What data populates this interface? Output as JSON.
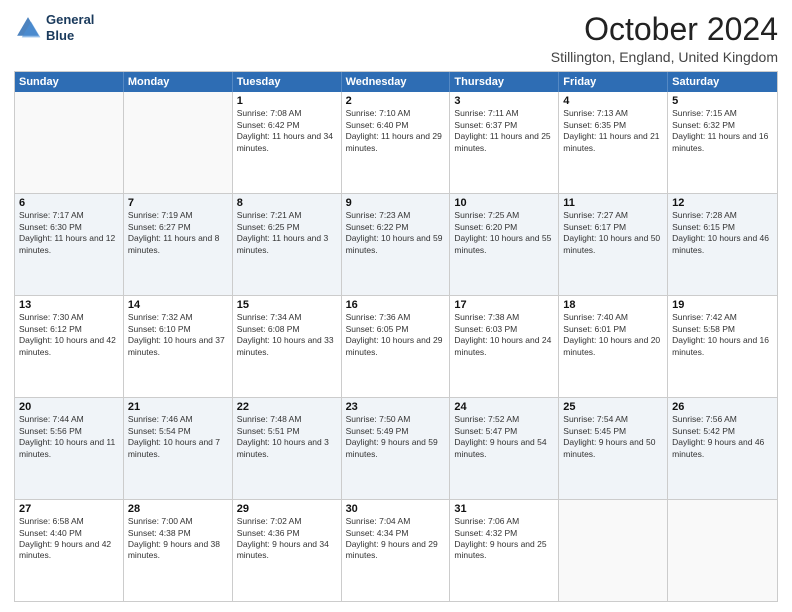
{
  "header": {
    "logo_line1": "General",
    "logo_line2": "Blue",
    "title": "October 2024",
    "subtitle": "Stillington, England, United Kingdom"
  },
  "days_of_week": [
    "Sunday",
    "Monday",
    "Tuesday",
    "Wednesday",
    "Thursday",
    "Friday",
    "Saturday"
  ],
  "weeks": [
    [
      {
        "day": "",
        "sunrise": "",
        "sunset": "",
        "daylight": "",
        "alt": false
      },
      {
        "day": "",
        "sunrise": "",
        "sunset": "",
        "daylight": "",
        "alt": false
      },
      {
        "day": "1",
        "sunrise": "Sunrise: 7:08 AM",
        "sunset": "Sunset: 6:42 PM",
        "daylight": "Daylight: 11 hours and 34 minutes.",
        "alt": false
      },
      {
        "day": "2",
        "sunrise": "Sunrise: 7:10 AM",
        "sunset": "Sunset: 6:40 PM",
        "daylight": "Daylight: 11 hours and 29 minutes.",
        "alt": false
      },
      {
        "day": "3",
        "sunrise": "Sunrise: 7:11 AM",
        "sunset": "Sunset: 6:37 PM",
        "daylight": "Daylight: 11 hours and 25 minutes.",
        "alt": false
      },
      {
        "day": "4",
        "sunrise": "Sunrise: 7:13 AM",
        "sunset": "Sunset: 6:35 PM",
        "daylight": "Daylight: 11 hours and 21 minutes.",
        "alt": false
      },
      {
        "day": "5",
        "sunrise": "Sunrise: 7:15 AM",
        "sunset": "Sunset: 6:32 PM",
        "daylight": "Daylight: 11 hours and 16 minutes.",
        "alt": false
      }
    ],
    [
      {
        "day": "6",
        "sunrise": "Sunrise: 7:17 AM",
        "sunset": "Sunset: 6:30 PM",
        "daylight": "Daylight: 11 hours and 12 minutes.",
        "alt": true
      },
      {
        "day": "7",
        "sunrise": "Sunrise: 7:19 AM",
        "sunset": "Sunset: 6:27 PM",
        "daylight": "Daylight: 11 hours and 8 minutes.",
        "alt": true
      },
      {
        "day": "8",
        "sunrise": "Sunrise: 7:21 AM",
        "sunset": "Sunset: 6:25 PM",
        "daylight": "Daylight: 11 hours and 3 minutes.",
        "alt": true
      },
      {
        "day": "9",
        "sunrise": "Sunrise: 7:23 AM",
        "sunset": "Sunset: 6:22 PM",
        "daylight": "Daylight: 10 hours and 59 minutes.",
        "alt": true
      },
      {
        "day": "10",
        "sunrise": "Sunrise: 7:25 AM",
        "sunset": "Sunset: 6:20 PM",
        "daylight": "Daylight: 10 hours and 55 minutes.",
        "alt": true
      },
      {
        "day": "11",
        "sunrise": "Sunrise: 7:27 AM",
        "sunset": "Sunset: 6:17 PM",
        "daylight": "Daylight: 10 hours and 50 minutes.",
        "alt": true
      },
      {
        "day": "12",
        "sunrise": "Sunrise: 7:28 AM",
        "sunset": "Sunset: 6:15 PM",
        "daylight": "Daylight: 10 hours and 46 minutes.",
        "alt": true
      }
    ],
    [
      {
        "day": "13",
        "sunrise": "Sunrise: 7:30 AM",
        "sunset": "Sunset: 6:12 PM",
        "daylight": "Daylight: 10 hours and 42 minutes.",
        "alt": false
      },
      {
        "day": "14",
        "sunrise": "Sunrise: 7:32 AM",
        "sunset": "Sunset: 6:10 PM",
        "daylight": "Daylight: 10 hours and 37 minutes.",
        "alt": false
      },
      {
        "day": "15",
        "sunrise": "Sunrise: 7:34 AM",
        "sunset": "Sunset: 6:08 PM",
        "daylight": "Daylight: 10 hours and 33 minutes.",
        "alt": false
      },
      {
        "day": "16",
        "sunrise": "Sunrise: 7:36 AM",
        "sunset": "Sunset: 6:05 PM",
        "daylight": "Daylight: 10 hours and 29 minutes.",
        "alt": false
      },
      {
        "day": "17",
        "sunrise": "Sunrise: 7:38 AM",
        "sunset": "Sunset: 6:03 PM",
        "daylight": "Daylight: 10 hours and 24 minutes.",
        "alt": false
      },
      {
        "day": "18",
        "sunrise": "Sunrise: 7:40 AM",
        "sunset": "Sunset: 6:01 PM",
        "daylight": "Daylight: 10 hours and 20 minutes.",
        "alt": false
      },
      {
        "day": "19",
        "sunrise": "Sunrise: 7:42 AM",
        "sunset": "Sunset: 5:58 PM",
        "daylight": "Daylight: 10 hours and 16 minutes.",
        "alt": false
      }
    ],
    [
      {
        "day": "20",
        "sunrise": "Sunrise: 7:44 AM",
        "sunset": "Sunset: 5:56 PM",
        "daylight": "Daylight: 10 hours and 11 minutes.",
        "alt": true
      },
      {
        "day": "21",
        "sunrise": "Sunrise: 7:46 AM",
        "sunset": "Sunset: 5:54 PM",
        "daylight": "Daylight: 10 hours and 7 minutes.",
        "alt": true
      },
      {
        "day": "22",
        "sunrise": "Sunrise: 7:48 AM",
        "sunset": "Sunset: 5:51 PM",
        "daylight": "Daylight: 10 hours and 3 minutes.",
        "alt": true
      },
      {
        "day": "23",
        "sunrise": "Sunrise: 7:50 AM",
        "sunset": "Sunset: 5:49 PM",
        "daylight": "Daylight: 9 hours and 59 minutes.",
        "alt": true
      },
      {
        "day": "24",
        "sunrise": "Sunrise: 7:52 AM",
        "sunset": "Sunset: 5:47 PM",
        "daylight": "Daylight: 9 hours and 54 minutes.",
        "alt": true
      },
      {
        "day": "25",
        "sunrise": "Sunrise: 7:54 AM",
        "sunset": "Sunset: 5:45 PM",
        "daylight": "Daylight: 9 hours and 50 minutes.",
        "alt": true
      },
      {
        "day": "26",
        "sunrise": "Sunrise: 7:56 AM",
        "sunset": "Sunset: 5:42 PM",
        "daylight": "Daylight: 9 hours and 46 minutes.",
        "alt": true
      }
    ],
    [
      {
        "day": "27",
        "sunrise": "Sunrise: 6:58 AM",
        "sunset": "Sunset: 4:40 PM",
        "daylight": "Daylight: 9 hours and 42 minutes.",
        "alt": false
      },
      {
        "day": "28",
        "sunrise": "Sunrise: 7:00 AM",
        "sunset": "Sunset: 4:38 PM",
        "daylight": "Daylight: 9 hours and 38 minutes.",
        "alt": false
      },
      {
        "day": "29",
        "sunrise": "Sunrise: 7:02 AM",
        "sunset": "Sunset: 4:36 PM",
        "daylight": "Daylight: 9 hours and 34 minutes.",
        "alt": false
      },
      {
        "day": "30",
        "sunrise": "Sunrise: 7:04 AM",
        "sunset": "Sunset: 4:34 PM",
        "daylight": "Daylight: 9 hours and 29 minutes.",
        "alt": false
      },
      {
        "day": "31",
        "sunrise": "Sunrise: 7:06 AM",
        "sunset": "Sunset: 4:32 PM",
        "daylight": "Daylight: 9 hours and 25 minutes.",
        "alt": false
      },
      {
        "day": "",
        "sunrise": "",
        "sunset": "",
        "daylight": "",
        "alt": false
      },
      {
        "day": "",
        "sunrise": "",
        "sunset": "",
        "daylight": "",
        "alt": false
      }
    ]
  ]
}
